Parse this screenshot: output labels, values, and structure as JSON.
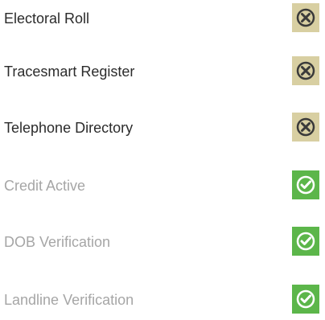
{
  "checks": [
    {
      "label": "Electoral Roll",
      "status": "fail",
      "icon": "x-circle-icon"
    },
    {
      "label": "Tracesmart Register",
      "status": "fail",
      "icon": "x-circle-icon"
    },
    {
      "label": "Telephone Directory",
      "status": "fail",
      "icon": "x-circle-icon"
    },
    {
      "label": "Credit Active",
      "status": "pass",
      "icon": "check-circle-icon"
    },
    {
      "label": "DOB Verification",
      "status": "pass",
      "icon": "check-circle-icon"
    },
    {
      "label": "Landline Verification",
      "status": "pass",
      "icon": "check-circle-icon"
    }
  ],
  "colors": {
    "fail_bg": "#d8cfa2",
    "fail_ring": "#3a3a3a",
    "pass_bg": "#5cb64a",
    "pass_ring": "#ffffff",
    "fail_text": "#2b2b2b",
    "pass_text": "#a6a6a6"
  }
}
